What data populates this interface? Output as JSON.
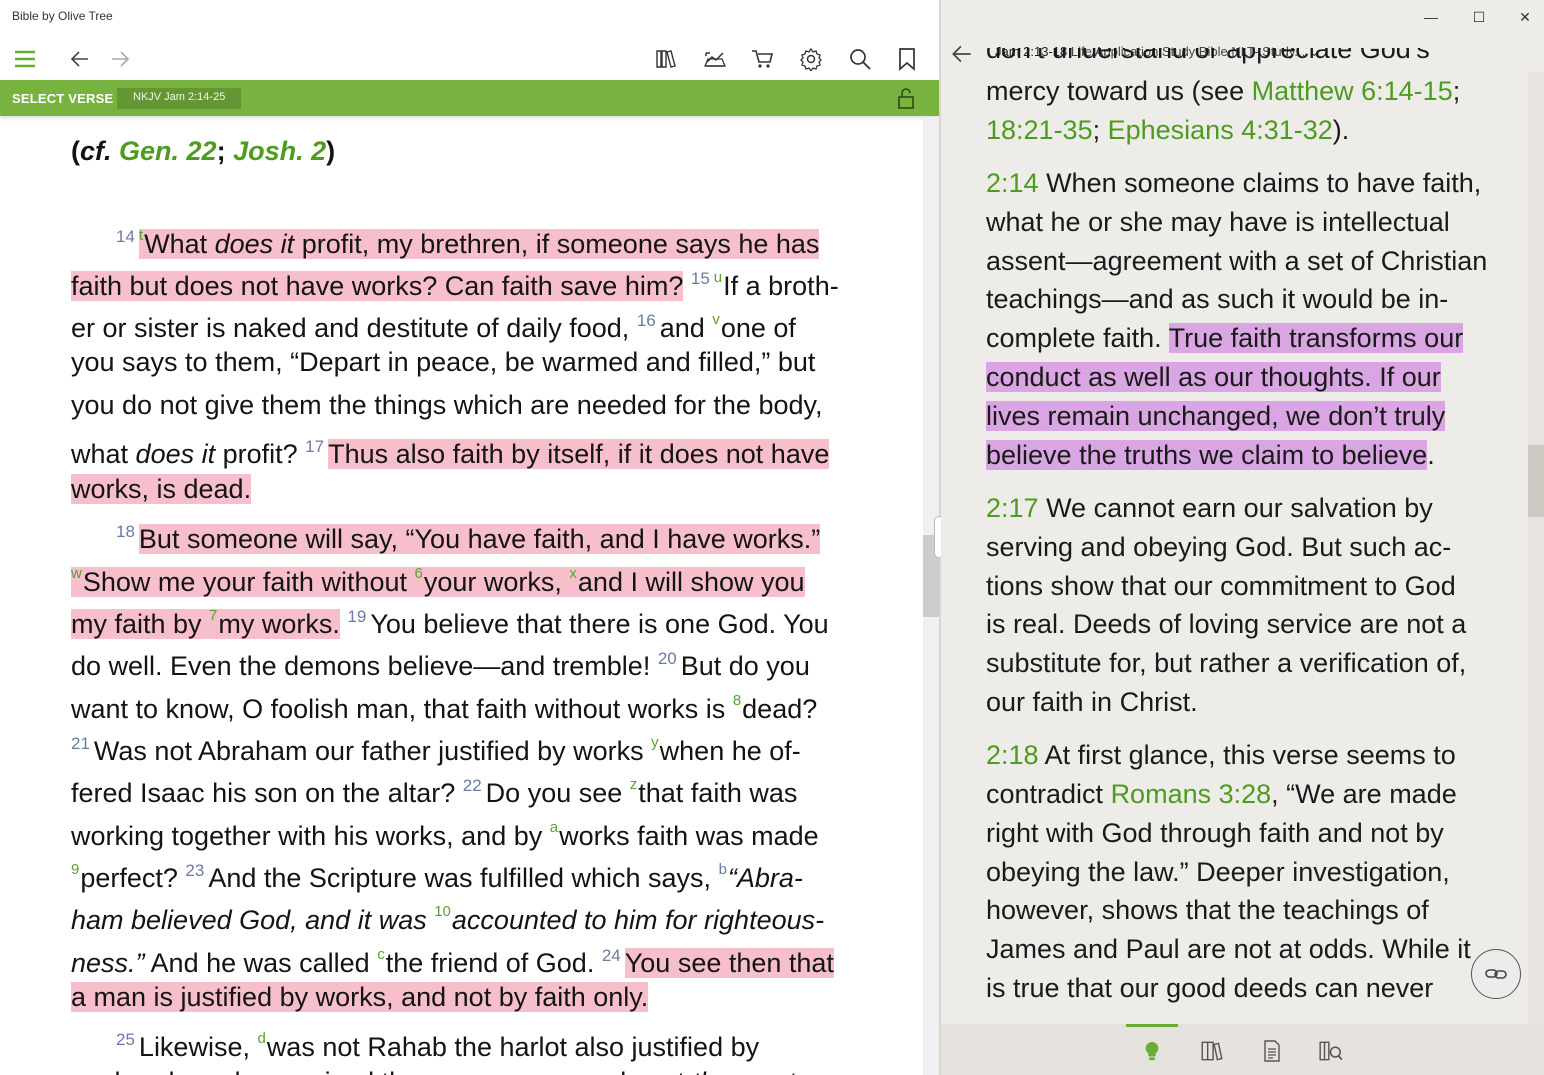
{
  "app": {
    "title": "Bible by Olive Tree"
  },
  "left": {
    "toolbar": {
      "menu": "hamburger-icon",
      "back": "arrow-left-icon",
      "forward": "arrow-right-icon",
      "library": "library-icon",
      "sync": "sync-chart-icon",
      "store": "cart-icon",
      "settings": "gear-icon",
      "search": "search-icon",
      "bookmark": "bookmark-icon"
    },
    "verse_bar": {
      "label": "SELECT VERSE",
      "reference": "NKJV Jam 2:14-25",
      "lock": "lock-icon"
    },
    "crossref": {
      "open": "(",
      "cf": "cf.",
      "gen": "Gen. 22",
      "sep": ";",
      "josh": "Josh. 2",
      "close": ")"
    },
    "verses": {
      "v14": {
        "num": "14",
        "fn_t": "t"
      },
      "v15": {
        "num": "15",
        "fn_u": "u"
      },
      "v16": {
        "num": "16",
        "fn_v": "v"
      },
      "v17": {
        "num": "17"
      },
      "v18": {
        "num": "18",
        "fn_w": "w",
        "fn_6": "6",
        "fn_x": "x",
        "fn_7": "7"
      },
      "v19": {
        "num": "19"
      },
      "v20": {
        "num": "20",
        "fn_8": "8"
      },
      "v21": {
        "num": "21",
        "fn_y": "y"
      },
      "v22": {
        "num": "22",
        "fn_z": "z",
        "fn_a": "a",
        "fn_9": "9"
      },
      "v23": {
        "num": "23",
        "fn_b": "b",
        "fn_10": "10",
        "fn_c": "c"
      },
      "v24": {
        "num": "24"
      },
      "v25": {
        "num": "25",
        "fn_d": "d"
      }
    },
    "lines": {
      "l1a": "What ",
      "l1b": "does it",
      "l1c": " profit, my brethren, if someone says he has",
      "l2a": "faith but does not have works? Can faith save him?",
      "l2b": "If a broth-",
      "l3a": "er or sister is naked and destitute of daily food, ",
      "l3b": "and ",
      "l3c": "one of",
      "l4": "you says to them, “Depart in peace, be warmed and filled,” but",
      "l5": "you do not give them the things which are needed for the body,",
      "l6a": "what ",
      "l6b": "does it",
      "l6c": " profit? ",
      "l6d": "Thus also faith by itself, if it does not have",
      "l7": "works, is dead.",
      "l8": "But someone will say, “You have faith, and I have works.”",
      "l9a": "Show me your faith without ",
      "l9b": "your works, ",
      "l9c": "and I will show you",
      "l10a": "my faith by ",
      "l10b": "my works.",
      "l10c": "You believe that there is one God. You",
      "l11a": "do well. Even the demons believe—and tremble! ",
      "l11b": "But do you",
      "l12a": "want to know, O foolish man, that faith without works is ",
      "l12b": "dead?",
      "l13a": "Was not Abraham our father justified by works ",
      "l13b": "when he of-",
      "l14a": "fered Isaac his son on the altar? ",
      "l14b": "Do you see ",
      "l14c": "that faith was",
      "l15a": "working together with his works, and by ",
      "l15b": "works faith was made",
      "l16a": "perfect? ",
      "l16b": "And the Scripture was fulfilled which says, ",
      "l16c": "“Abra-",
      "l17a": "ham believed God, and it was ",
      "l17b": "accounted to him for righteous-",
      "l18a": "ness.”",
      "l18b": " And he was called ",
      "l18c": "the friend of God. ",
      "l18d": "You see then that",
      "l19": "a man is justified by works, and not by faith only.",
      "l20a": "Likewise, ",
      "l20b": "was not Rahab the harlot also justified by",
      "l21a": "works when she received the messengers and sent ",
      "l21b": "them",
      "l21c": " out an-"
    }
  },
  "right": {
    "window": {
      "minimize": "—",
      "maximize": "☐",
      "close": "✕"
    },
    "header": {
      "back": "arrow-left-icon",
      "ref": "Jam 2:13-18",
      "title": " Life Application Study Bible NLT-  Study...",
      "chev": "⌄"
    },
    "commentary": {
      "c0": "don’t understand or appreciate God’s",
      "c1a": "mercy toward us (see ",
      "c1b": "Matthew 6:14-15",
      "c1c": ";",
      "c2a": "18:21-35",
      "c2b": "; ",
      "c2c": "Ephesians 4:31-32",
      "c2d": ").",
      "n214": "2:14",
      "c3": " When someone claims to have faith,",
      "c4": "what he or she may have is intellectual",
      "c5": "assent—agreement with a set of Christian",
      "c6": "teachings—and as such it would be in-",
      "c7a": "complete faith. ",
      "c7b": "True faith transforms our",
      "c8": "conduct as well as our thoughts. If our",
      "c9": "lives remain unchanged, we don’t truly",
      "c10a": "believe the truths we claim to believe",
      "c10b": ".",
      "n217": "2:17",
      "c11": " We cannot earn our salvation by",
      "c12": "serving and obeying God. But such ac-",
      "c13": "tions show that our commitment to God",
      "c14": "is real. Deeds of loving service are not a",
      "c15": "substitute for, but rather a verification of,",
      "c16": "our faith in Christ.",
      "n218": "2:18",
      "c17": " At first glance, this verse seems to",
      "c18a": "contradict ",
      "c18b": "Romans 3:28",
      "c18c": ", “We are made",
      "c19": "right with God through faith and not by",
      "c20": "obeying the law.” Deeper investigation,",
      "c21": "however, shows that the teachings of",
      "c22": "James and Paul are not at odds. While it",
      "c23": "is true that our good deeds can never"
    },
    "bottom_bar": {
      "notes": "lightbulb-icon",
      "library": "books-icon",
      "document": "document-icon",
      "search": "search-book-icon"
    },
    "link_button": "link-icon"
  },
  "colors": {
    "accent_green": "#79b33f",
    "link_green": "#4d9b1f",
    "pink_highlight": "#f7bfcc",
    "purple_highlight": "#d9a5e2",
    "panel_bg": "#eeece9"
  }
}
